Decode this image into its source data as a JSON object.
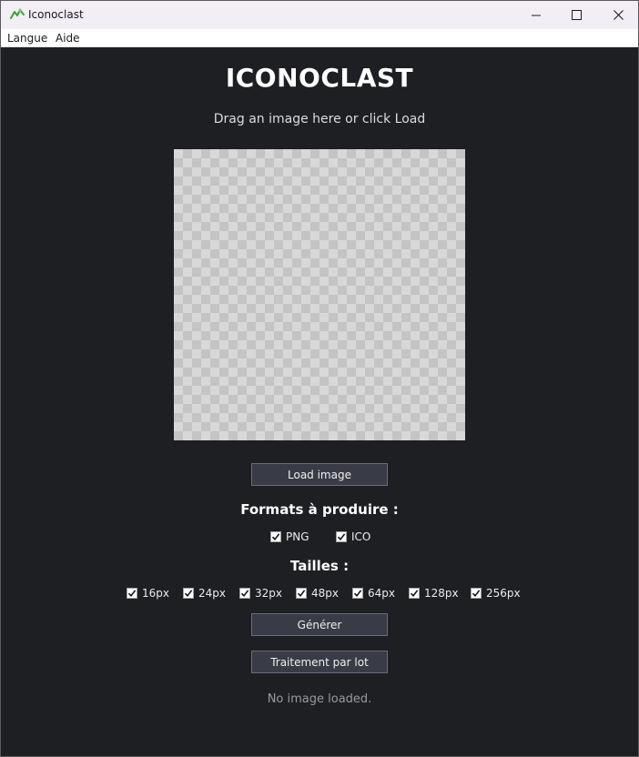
{
  "window": {
    "title": "Iconoclast",
    "controls": {
      "minimize": "minimize-icon",
      "maximize": "maximize-icon",
      "close": "close-icon"
    }
  },
  "menubar": {
    "items": [
      {
        "label": "Langue"
      },
      {
        "label": "Aide"
      }
    ]
  },
  "main": {
    "title": "ICONOCLAST",
    "subtitle": "Drag an image here or click Load",
    "load_button": "Load image",
    "formats_title": "Formats à produire :",
    "formats": [
      {
        "label": "PNG",
        "checked": true
      },
      {
        "label": "ICO",
        "checked": true
      }
    ],
    "sizes_title": "Tailles :",
    "sizes": [
      {
        "label": "16px",
        "checked": true
      },
      {
        "label": "24px",
        "checked": true
      },
      {
        "label": "32px",
        "checked": true
      },
      {
        "label": "48px",
        "checked": true
      },
      {
        "label": "64px",
        "checked": true
      },
      {
        "label": "128px",
        "checked": true
      },
      {
        "label": "256px",
        "checked": true
      }
    ],
    "generate_button": "Générer",
    "batch_button": "Traitement par lot",
    "status": "No image loaded."
  },
  "colors": {
    "background": "#1e1f23",
    "button": "#393b46",
    "titlebar": "#f3eef6",
    "app_icon": "#3aa635"
  }
}
